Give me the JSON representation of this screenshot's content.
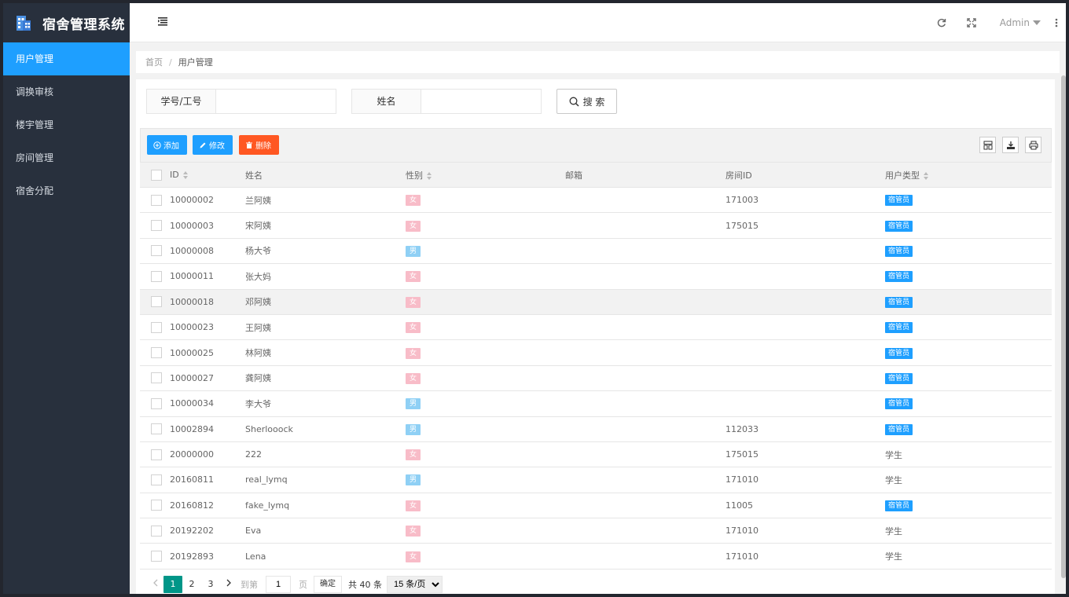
{
  "app": {
    "title": "宿舍管理系统"
  },
  "sidebar": {
    "items": [
      {
        "label": "用户管理",
        "active": true
      },
      {
        "label": "调换审核",
        "active": false
      },
      {
        "label": "楼宇管理",
        "active": false
      },
      {
        "label": "房间管理",
        "active": false
      },
      {
        "label": "宿舍分配",
        "active": false
      }
    ]
  },
  "topbar": {
    "user": "Admin"
  },
  "breadcrumb": {
    "home": "首页",
    "sep": "/",
    "current": "用户管理"
  },
  "search": {
    "field1_label": "学号/工号",
    "field1_value": "",
    "field2_label": "姓名",
    "field2_value": "",
    "button_label": "搜 索"
  },
  "toolbar": {
    "add_label": "添加",
    "edit_label": "修改",
    "delete_label": "删除"
  },
  "table": {
    "columns": [
      "ID",
      "姓名",
      "性别",
      "邮箱",
      "房间ID",
      "用户类型"
    ],
    "rows": [
      {
        "id": "10000002",
        "name": "兰阿姨",
        "gender": "女",
        "email": "",
        "room": "171003",
        "type": "宿管员",
        "type_tag": true
      },
      {
        "id": "10000003",
        "name": "宋阿姨",
        "gender": "女",
        "email": "",
        "room": "175015",
        "type": "宿管员",
        "type_tag": true
      },
      {
        "id": "10000008",
        "name": "杨大爷",
        "gender": "男",
        "email": "",
        "room": "",
        "type": "宿管员",
        "type_tag": true
      },
      {
        "id": "10000011",
        "name": "张大妈",
        "gender": "女",
        "email": "",
        "room": "",
        "type": "宿管员",
        "type_tag": true
      },
      {
        "id": "10000018",
        "name": "邓阿姨",
        "gender": "女",
        "email": "",
        "room": "",
        "type": "宿管员",
        "type_tag": true,
        "highlight": true
      },
      {
        "id": "10000023",
        "name": "王阿姨",
        "gender": "女",
        "email": "",
        "room": "",
        "type": "宿管员",
        "type_tag": true
      },
      {
        "id": "10000025",
        "name": "林阿姨",
        "gender": "女",
        "email": "",
        "room": "",
        "type": "宿管员",
        "type_tag": true
      },
      {
        "id": "10000027",
        "name": "龚阿姨",
        "gender": "女",
        "email": "",
        "room": "",
        "type": "宿管员",
        "type_tag": true
      },
      {
        "id": "10000034",
        "name": "李大爷",
        "gender": "男",
        "email": "",
        "room": "",
        "type": "宿管员",
        "type_tag": true
      },
      {
        "id": "10002894",
        "name": "Sherlooock",
        "gender": "男",
        "email": "",
        "room": "112033",
        "type": "宿管员",
        "type_tag": true
      },
      {
        "id": "20000000",
        "name": "222",
        "gender": "女",
        "email": "",
        "room": "175015",
        "type": "学生",
        "type_tag": false
      },
      {
        "id": "20160811",
        "name": "real_lymq",
        "gender": "男",
        "email": "",
        "room": "171010",
        "type": "学生",
        "type_tag": false
      },
      {
        "id": "20160812",
        "name": "fake_lymq",
        "gender": "女",
        "email": "",
        "room": "11005",
        "type": "宿管员",
        "type_tag": true
      },
      {
        "id": "20192202",
        "name": "Eva",
        "gender": "女",
        "email": "",
        "room": "171010",
        "type": "学生",
        "type_tag": false
      },
      {
        "id": "20192893",
        "name": "Lena",
        "gender": "女",
        "email": "",
        "room": "171010",
        "type": "学生",
        "type_tag": false
      }
    ]
  },
  "pagination": {
    "pages": [
      "1",
      "2",
      "3"
    ],
    "current": "1",
    "goto_label": "到第",
    "goto_value": "1",
    "page_suffix": "页",
    "confirm_label": "确定",
    "total": "共 40 条",
    "page_size": "15 条/页"
  },
  "colors": {
    "primary": "#1e9fff",
    "danger": "#ff5722",
    "pager_current": "#009688",
    "sidebar_bg": "#28303d"
  }
}
